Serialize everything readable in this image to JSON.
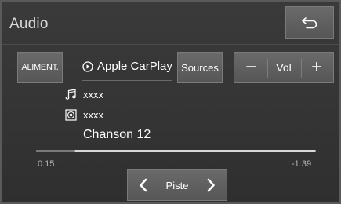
{
  "header": {
    "title": "Audio",
    "back_icon": "return-arrow-icon"
  },
  "controls": {
    "aliment_label": "ALIMENT.",
    "source_name": "Apple CarPlay",
    "source_icon": "play-circle-icon",
    "sources_label": "Sources",
    "volume": {
      "minus": "−",
      "label": "Vol",
      "plus": "+"
    }
  },
  "track": {
    "line1_icon": "music-note-icon",
    "line1_text": "xxxx",
    "line2_icon": "album-icon",
    "line2_text": "xxxx",
    "title": "Chanson 12",
    "elapsed": "0:15",
    "remaining": "-1:39",
    "progress_fraction": 0.14
  },
  "navigation": {
    "label": "Piste",
    "prev_icon": "chevron-left-icon",
    "next_icon": "chevron-right-icon"
  }
}
